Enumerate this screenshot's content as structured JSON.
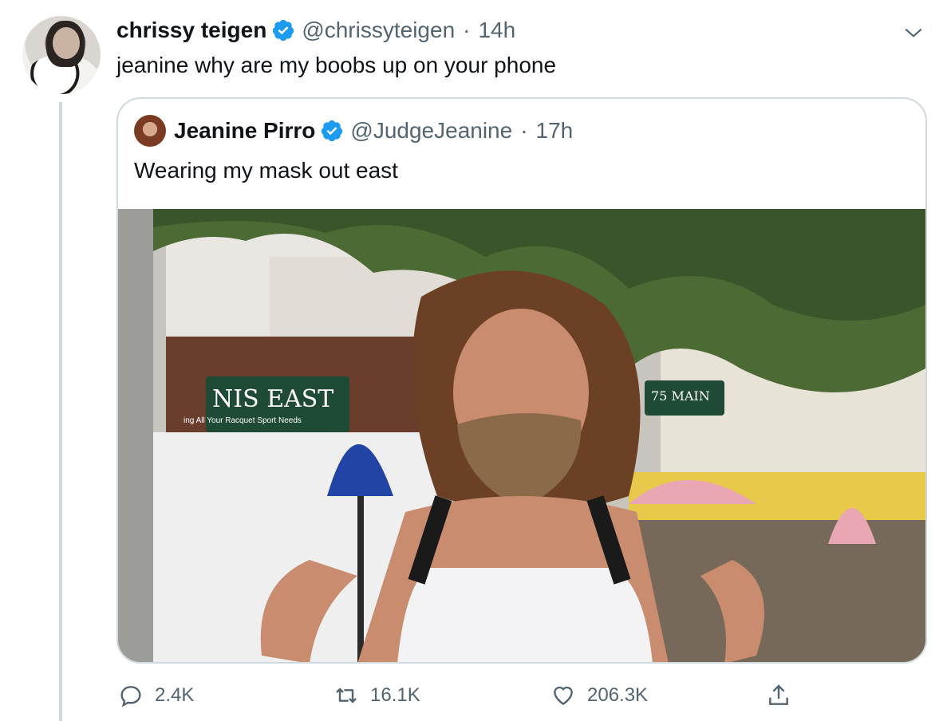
{
  "tweet": {
    "name": "chrissy teigen",
    "handle": "@chrissyteigen",
    "separator": "·",
    "time": "14h",
    "text": "jeanine why are my boobs up on your phone"
  },
  "quoted": {
    "name": "Jeanine Pirro",
    "handle": "@JudgeJeanine",
    "separator": "·",
    "time": "17h",
    "text": "Wearing my mask out east",
    "photo_sign_text": "NIS EAST",
    "photo_sign_subtext": "ing All Your Racquet Sport Needs",
    "photo_sign2_text": "75 MAIN"
  },
  "actions": {
    "reply_count": "2.4K",
    "retweet_count": "16.1K",
    "like_count": "206.3K"
  },
  "icons": [
    "verified-badge-icon",
    "chevron-down-icon",
    "reply-icon",
    "retweet-icon",
    "like-icon",
    "share-icon"
  ],
  "colors": {
    "verified": "#1d9bf0",
    "muted": "#536471",
    "border": "#cfd9de"
  }
}
